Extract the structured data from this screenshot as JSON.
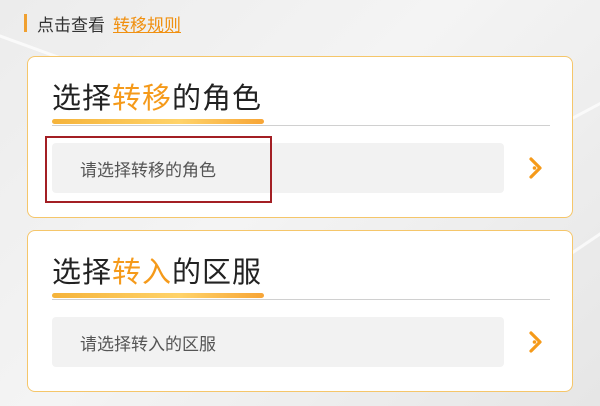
{
  "top": {
    "prefix": "点击查看",
    "link": "转移规则"
  },
  "card_role": {
    "title_before": "选择",
    "title_highlight": "转移",
    "title_after": "的角色",
    "placeholder": "请选择转移的角色"
  },
  "card_server": {
    "title_before": "选择",
    "title_highlight": "转入",
    "title_after": "的区服",
    "placeholder": "请选择转入的区服"
  },
  "colors": {
    "accent": "#f59a1a",
    "card_border": "#f5c66a",
    "highlight_frame": "#a31f24"
  },
  "icons": {
    "chevron": "chevron-right-icon"
  }
}
